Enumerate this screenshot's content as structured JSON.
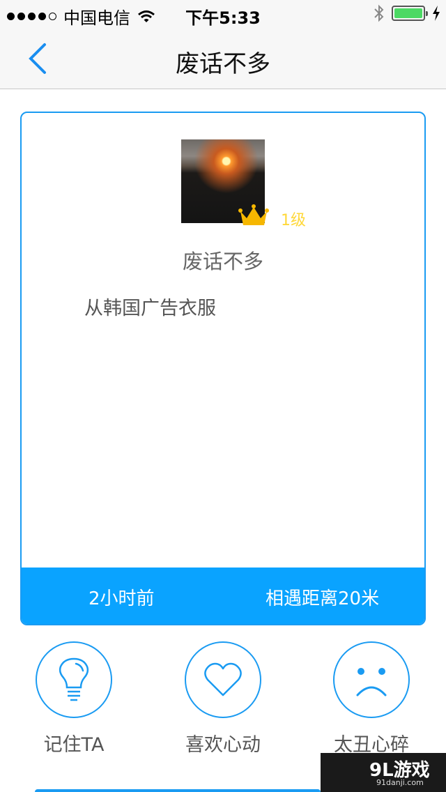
{
  "status_bar": {
    "carrier": "中国电信",
    "time": "下午5:33"
  },
  "nav": {
    "title": "废话不多"
  },
  "profile": {
    "level": "1级",
    "nickname": "废话不多",
    "description": "从韩国广告衣服"
  },
  "card_footer": {
    "time_ago": "2小时前",
    "distance": "相遇距离20米"
  },
  "actions": [
    {
      "label": "记住TA",
      "icon": "lightbulb-icon"
    },
    {
      "label": "喜欢心动",
      "icon": "heart-icon"
    },
    {
      "label": "太丑心碎",
      "icon": "sad-face-icon"
    }
  ],
  "watermark": {
    "logo": "9L游戏",
    "site": "91danji.com"
  },
  "colors": {
    "accent": "#1a9bf2",
    "footer": "#0aa3ff",
    "level": "#ffd83a",
    "crown": "#f6b700"
  }
}
